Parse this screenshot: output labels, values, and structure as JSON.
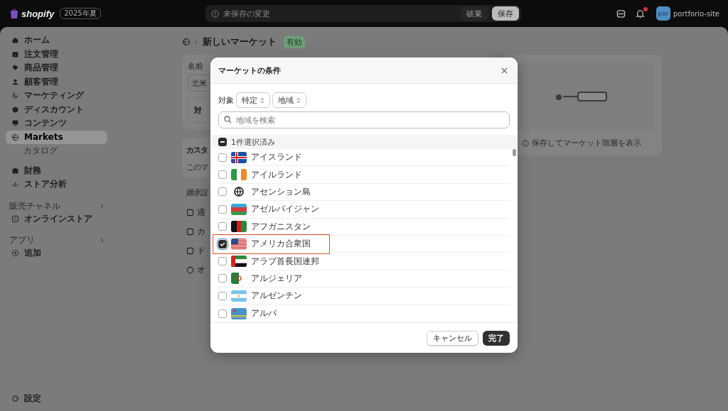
{
  "topbar": {
    "logo": "shopify",
    "edition": "2025年夏",
    "unsaved_notice": "未保存の変更",
    "discard_button": "破棄",
    "save_button": "保存",
    "notification_unread": true,
    "avatar_initials": "por",
    "store_name": "portforio-site"
  },
  "sidebar": {
    "groups": [
      [
        {
          "label": "ホーム",
          "selected": false
        },
        {
          "label": "注文管理",
          "selected": false
        },
        {
          "label": "商品管理",
          "selected": false
        },
        {
          "label": "顧客管理",
          "selected": false
        },
        {
          "label": "マーケティング",
          "selected": false
        },
        {
          "label": "ディスカウント",
          "selected": false
        },
        {
          "label": "コンテンツ",
          "selected": false
        },
        {
          "label": "Markets",
          "selected": true,
          "children": [
            {
              "label": "カタログ",
              "selected": false
            }
          ]
        }
      ],
      [
        {
          "label": "財務",
          "selected": false
        },
        {
          "label": "ストア分析",
          "selected": false
        }
      ]
    ],
    "sections": [
      {
        "title": "販売チャネル",
        "items": [
          {
            "label": "オンラインストア",
            "selected": false
          }
        ]
      },
      {
        "title": "アプリ",
        "items": [
          {
            "label": "追加",
            "selected": false
          }
        ]
      }
    ],
    "settings": "設定"
  },
  "page": {
    "title": "新しいマーケット",
    "status": "有効",
    "name_label": "名前",
    "name_value": "北米",
    "target_text": "対",
    "hierarchy_note": "保存してマーケット階層を表示",
    "custom_title": "カスタ",
    "custom_text": "このマ",
    "inherited_label": "継承設",
    "inherited_rows": [
      "適",
      "カ",
      "ド",
      "オ"
    ]
  },
  "modal": {
    "title": "マーケットの条件",
    "filter_label": "対象",
    "selects": [
      "特定",
      "地域"
    ],
    "search": {
      "placeholder": "地域を検索"
    },
    "select_all": {
      "label": "1件選択済み",
      "partial": true
    },
    "regions": [
      {
        "name": "アイスランド",
        "kind": "flag",
        "checked": false,
        "outlined": false
      },
      {
        "name": "アイルランド",
        "kind": "flag",
        "checked": false,
        "outlined": false
      },
      {
        "name": "アセンション島",
        "kind": "globe",
        "checked": false,
        "outlined": false
      },
      {
        "name": "アゼルバイジャン",
        "kind": "flag",
        "checked": false,
        "outlined": false
      },
      {
        "name": "アフガニスタン",
        "kind": "flag",
        "checked": false,
        "outlined": false
      },
      {
        "name": "アメリカ合衆国",
        "kind": "flag",
        "checked": true,
        "outlined": true
      },
      {
        "name": "アラブ首長国連邦",
        "kind": "flag",
        "checked": false,
        "outlined": false
      },
      {
        "name": "アルジェリア",
        "kind": "flag",
        "checked": false,
        "outlined": false
      },
      {
        "name": "アルゼンチン",
        "kind": "flag",
        "checked": false,
        "outlined": false
      },
      {
        "name": "アルバ",
        "kind": "flag",
        "checked": false,
        "outlined": false
      }
    ],
    "cancel_button": "キャンセル",
    "done_button": "完了"
  }
}
